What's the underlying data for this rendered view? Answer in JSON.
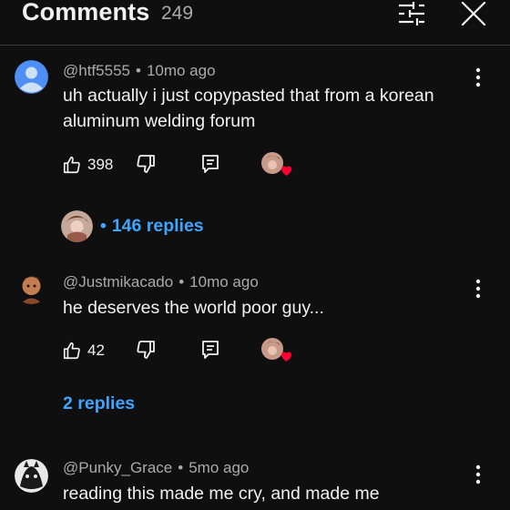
{
  "header": {
    "title": "Comments",
    "count": "249"
  },
  "comments": [
    {
      "author": "@htf5555",
      "time": "10mo ago",
      "text": "uh actually i just copypasted that from a korean aluminum welding forum",
      "likes": "398",
      "replies_label": "146 replies",
      "replies_prefix": "•"
    },
    {
      "author": "@Justmikacado",
      "time": "10mo ago",
      "text": "he deserves the world poor guy...",
      "likes": "42",
      "replies_label": "2 replies"
    },
    {
      "author": "@Punky_Grace",
      "time": "5mo ago",
      "text": "reading this made me cry, and made me"
    }
  ],
  "separator": "•",
  "icons": {
    "filter": "sliders-icon",
    "close": "close-icon",
    "more": "more-vertical-icon",
    "like": "thumbs-up-icon",
    "dislike": "thumbs-down-icon",
    "reply": "reply-icon",
    "heart": "creator-heart-icon"
  },
  "colors": {
    "background": "#0f0f0f",
    "link": "#3ea6ff",
    "heart": "#ff0033"
  }
}
